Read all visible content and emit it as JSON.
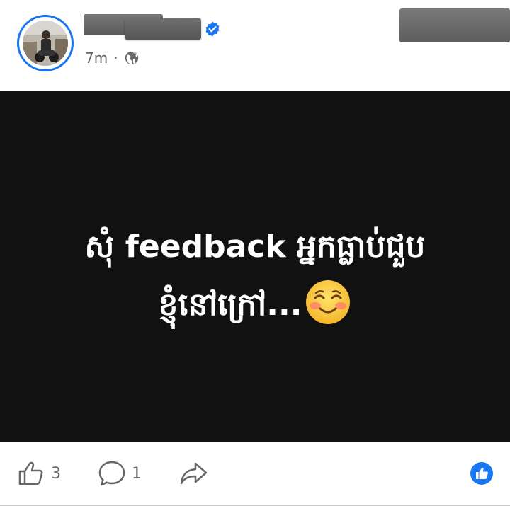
{
  "post": {
    "timestamp": "7m",
    "separator": "·",
    "privacy_icon": "globe-icon",
    "author_verified_icon": "verified-badge-icon",
    "image_text_line1": "សុំ feedback អ្នកធ្លាប់ជួប",
    "image_text_line2": "ខ្ញុំនៅក្រៅ...",
    "image_emoji": "smiling-face-with-blush-icon",
    "image_background": "#111111"
  },
  "actions": {
    "like_count": "3",
    "comment_count": "1",
    "like_icon": "thumbs-up-outline-icon",
    "comment_icon": "comment-bubble-icon",
    "share_icon": "share-arrow-icon",
    "reaction_icon": "like-reaction-icon"
  },
  "colors": {
    "accent": "#1877f2",
    "meta_text": "#65676b"
  }
}
